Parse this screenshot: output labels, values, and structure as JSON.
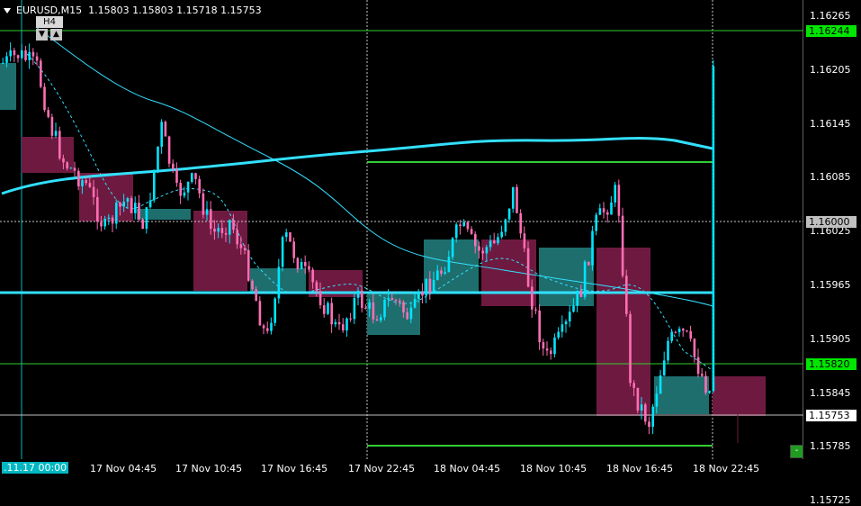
{
  "window": {
    "symbol_timeframe": "EURUSD,M15",
    "ohlc": "1.15803 1.15803 1.15718 1.15753"
  },
  "timeframe_badge": {
    "label": "H4",
    "down_icon": "▼",
    "up_icon": "▲"
  },
  "price_axis": {
    "ticks": [
      "1.16265",
      "1.16205",
      "1.16145",
      "1.16085",
      "1.16025",
      "1.15965",
      "1.15905",
      "1.15845",
      "1.15785",
      "1.15725"
    ],
    "tags": [
      {
        "id": "level-high",
        "text": "1.16244",
        "bg": "#00e600",
        "fg": "#000000"
      },
      {
        "id": "level-crosshair",
        "text": "1.16000",
        "bg": "#c0c0c0",
        "fg": "#000000"
      },
      {
        "id": "level-mid",
        "text": "1.15820",
        "bg": "#00e600",
        "fg": "#000000"
      },
      {
        "id": "level-bid",
        "text": "1.15753",
        "bg": "#ffffff",
        "fg": "#000000"
      }
    ]
  },
  "time_axis": {
    "labels": [
      ".11.17 00:00",
      "17 Nov 04:45",
      "17 Nov 10:45",
      "17 Nov 16:45",
      "17 Nov 22:45",
      "18 Nov 04:45",
      "18 Nov 10:45",
      "18 Nov 16:45",
      "18 Nov 22:45"
    ]
  },
  "minus_button": "-",
  "colors": {
    "background": "#000000",
    "bull_candle": "#00e5ff",
    "bear_candle": "#ff6eb4",
    "bull_box": "#1e6e6e",
    "bear_box": "#6e1a40",
    "level_line": "#32cd32",
    "ma_line": "#33e0ff"
  }
}
